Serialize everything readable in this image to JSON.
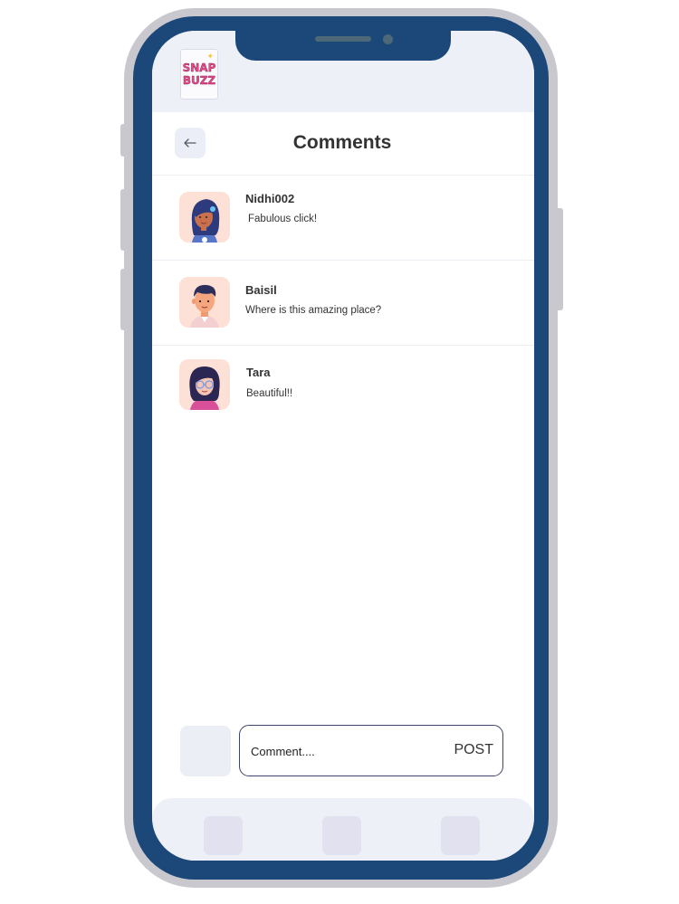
{
  "app": {
    "logo_line1": "SNAP",
    "logo_line2": "BUZZ"
  },
  "header": {
    "back_icon": "arrow-left-icon",
    "title": "Comments"
  },
  "comments": [
    {
      "username": "Nidhi002",
      "text": "Fabulous click!",
      "avatar": "girl-avatar-blue-hair"
    },
    {
      "username": "Baisil",
      "text": "Where is this amazing place?",
      "avatar": "boy-avatar"
    },
    {
      "username": "Tara",
      "text": "Beautiful!!",
      "avatar": "girl-avatar-glasses"
    }
  ],
  "composer": {
    "placeholder": "Comment....",
    "post_label": "POST"
  },
  "colors": {
    "frame": "#1b4879",
    "accent_border": "#3e4468",
    "surface": "#eef0f8"
  }
}
